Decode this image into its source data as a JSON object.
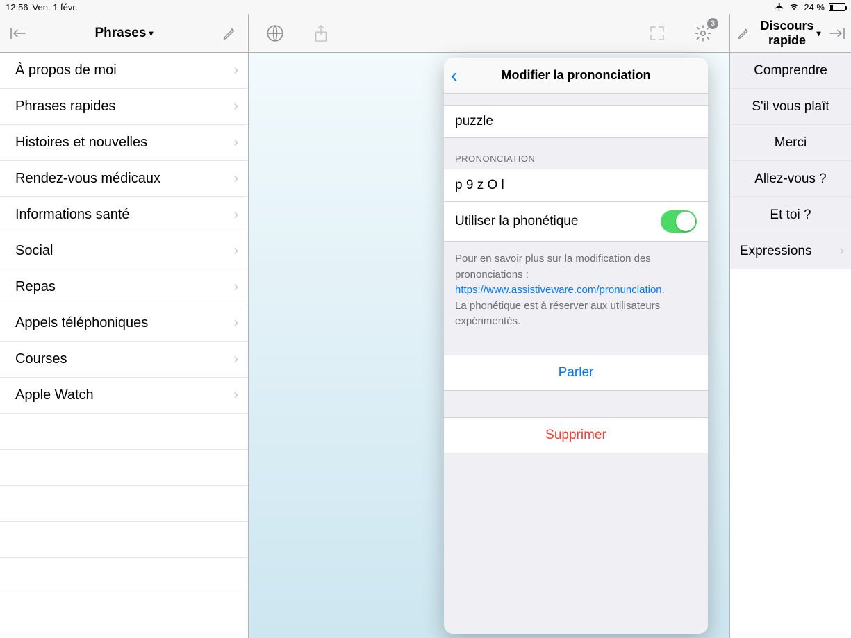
{
  "status": {
    "time": "12:56",
    "date": "Ven. 1 févr.",
    "battery_pct": "24 %"
  },
  "left": {
    "title": "Phrases",
    "items": [
      "À propos de moi",
      "Phrases rapides",
      "Histoires et nouvelles",
      "Rendez-vous médicaux",
      "Informations santé",
      "Social",
      "Repas",
      "Appels téléphoniques",
      "Courses",
      "Apple Watch"
    ]
  },
  "mid": {
    "gear_badge": "3"
  },
  "right": {
    "title": "Discours rapide",
    "items": [
      "Comprendre",
      "S'il vous plaît",
      "Merci",
      "Allez-vous ?",
      "Et toi ?",
      "Expressions"
    ]
  },
  "popover": {
    "title": "Modifier la prononciation",
    "word": "puzzle",
    "section_label": "PRONONCIATION",
    "phonetic": "p 9 z O l",
    "toggle_label": "Utiliser la phonétique",
    "help_prefix": "Pour en savoir plus sur la modification des prononciations : ",
    "help_link_text": "https://www.assistiveware.com/pronunciation",
    "help_suffix": ".",
    "help_note": "La phonétique est à réserver aux utilisateurs expérimentés.",
    "speak": "Parler",
    "delete": "Supprimer"
  }
}
